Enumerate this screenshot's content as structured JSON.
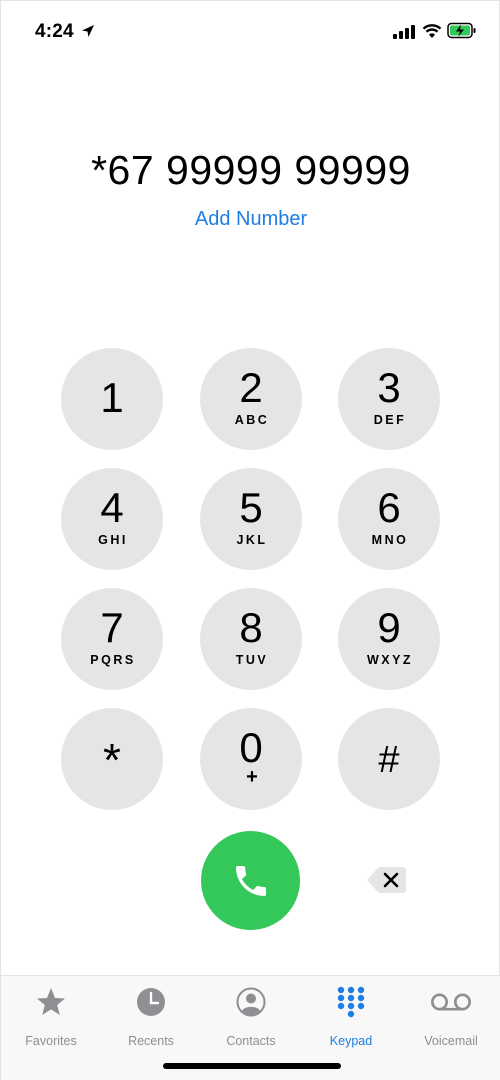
{
  "status_bar": {
    "time": "4:24",
    "icons": [
      "location-arrow-icon",
      "cellular-signal-icon",
      "wifi-icon",
      "battery-charging-icon"
    ]
  },
  "display": {
    "number": "*67 99999 99999",
    "add_number": "Add Number"
  },
  "keypad": {
    "keys": [
      {
        "digit": "1",
        "letters": ""
      },
      {
        "digit": "2",
        "letters": "ABC"
      },
      {
        "digit": "3",
        "letters": "DEF"
      },
      {
        "digit": "4",
        "letters": "GHI"
      },
      {
        "digit": "5",
        "letters": "JKL"
      },
      {
        "digit": "6",
        "letters": "MNO"
      },
      {
        "digit": "7",
        "letters": "PQRS"
      },
      {
        "digit": "8",
        "letters": "TUV"
      },
      {
        "digit": "9",
        "letters": "WXYZ"
      },
      {
        "digit": "*",
        "letters": ""
      },
      {
        "digit": "0",
        "letters": "+"
      },
      {
        "digit": "#",
        "letters": ""
      }
    ]
  },
  "actions": {
    "call_icon": "phone-icon",
    "delete_icon": "delete-backspace-icon"
  },
  "tab_bar": {
    "tabs": [
      {
        "label": "Favorites",
        "icon": "star-icon"
      },
      {
        "label": "Recents",
        "icon": "clock-icon"
      },
      {
        "label": "Contacts",
        "icon": "person-circle-icon"
      },
      {
        "label": "Keypad",
        "icon": "keypad-grid-icon"
      },
      {
        "label": "Voicemail",
        "icon": "voicemail-icon"
      }
    ],
    "active": "Keypad"
  },
  "colors": {
    "accent": "#1f7ee4",
    "call_green": "#34c759",
    "key_bg": "#e5e5e5",
    "inactive_tab": "#8e8e93"
  }
}
